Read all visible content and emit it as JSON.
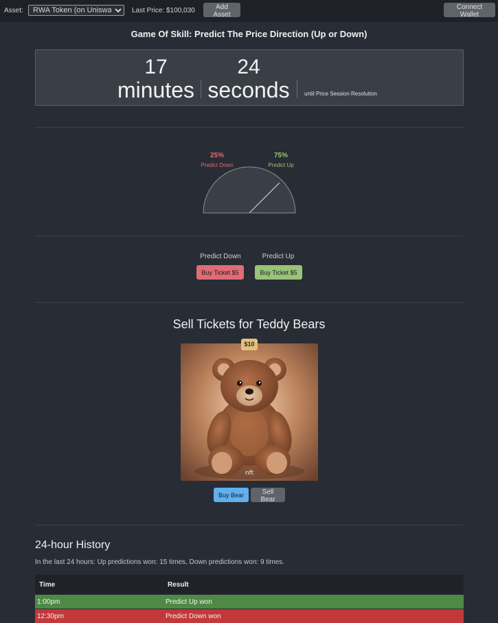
{
  "topbar": {
    "asset_label": "Asset:",
    "asset_selected": "RWA Token (on Uniswap)",
    "last_price": "Last Price: $100,030",
    "add_asset": "Add Asset",
    "connect_wallet": "Connect Wallet"
  },
  "game": {
    "title": "Game Of Skill: Predict The Price Direction (Up or Down)",
    "minutes_value": "17",
    "minutes_label": "minutes",
    "seconds_value": "24",
    "seconds_label": "seconds",
    "until_text": "until Price Session Resolution"
  },
  "gauge": {
    "down_pct": "25%",
    "down_label": "Predict Down",
    "up_pct": "75%",
    "up_label": "Predict Up",
    "up_fraction": 0.75
  },
  "predict": {
    "down_label": "Predict Down",
    "down_button": "Buy Ticket $5",
    "up_label": "Predict Up",
    "up_button": "Buy Ticket $5"
  },
  "sell": {
    "title": "Sell Tickets for Teddy Bears",
    "price_badge": "$10",
    "nft_tag": "nft",
    "buy_button": "Buy Bear",
    "sell_button": "Sell Bear"
  },
  "history": {
    "title": "24-hour History",
    "summary": "In the last 24 hours: Up predictions won: 15 times, Down predictions won: 9 times.",
    "columns": [
      "Time",
      "Result"
    ],
    "rows": [
      {
        "time": "1:00pm",
        "result": "Predict Up won"
      },
      {
        "time": "12:30pm",
        "result": "Predict Down won"
      }
    ]
  },
  "colors": {
    "background": "#282c34",
    "down": "#e06c75",
    "up": "#98c379",
    "accent": "#61afef",
    "badge": "#e5c07b"
  }
}
